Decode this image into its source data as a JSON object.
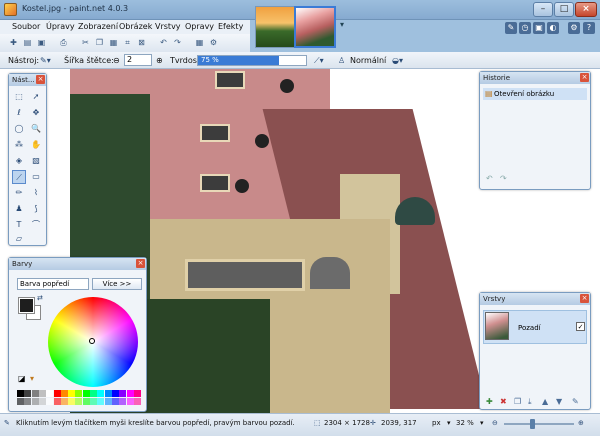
{
  "app": {
    "title": "Kostel.jpg - paint.net 4.0.3"
  },
  "menu": [
    "Soubor",
    "Úpravy",
    "Zobrazení",
    "Obrázek",
    "Vrstvy",
    "Opravy",
    "Efekty"
  ],
  "toolbar2": {
    "tool_label": "Nástroj:",
    "brush_width_label": "Šířka štětce:",
    "brush_width_value": "2",
    "hardness_label": "Tvrdost:",
    "hardness_value": "75 %",
    "hardness_fraction": 0.75,
    "blend_mode": "Normální"
  },
  "tools_panel": {
    "title": "Nást..."
  },
  "colors_panel": {
    "title": "Barvy",
    "select_value": "Barva popředí",
    "more_button": "Více >>",
    "primary_color": "#1e1e1e",
    "secondary_color": "#ffffff"
  },
  "history_panel": {
    "title": "Historie",
    "items": [
      "Otevření obrázku"
    ]
  },
  "layers_panel": {
    "title": "Vrstvy",
    "layers": [
      {
        "name": "Pozadí",
        "visible": true
      }
    ]
  },
  "status": {
    "hint": "Kliknutím levým tlačítkem myši kreslíte barvou popředí, pravým barvou pozadí.",
    "image_size": "2304 × 1728",
    "cursor_pos": "2039, 317",
    "unit": "px",
    "zoom": "32 %"
  },
  "icons": {
    "close": "×",
    "minimize": "–",
    "maximize": "□"
  }
}
